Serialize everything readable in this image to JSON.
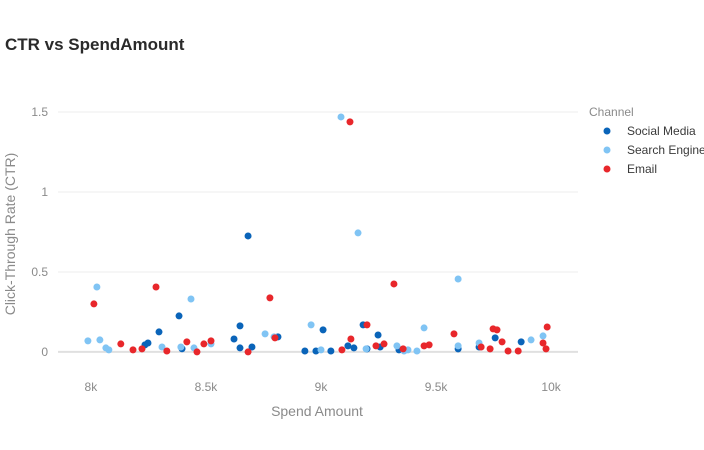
{
  "chart_data": {
    "type": "scatter",
    "title": "CTR vs SpendAmount",
    "xlabel": "Spend Amount",
    "ylabel": "Click-Through Rate (CTR)",
    "xlim": [
      7857,
      10117
    ],
    "ylim": [
      -0.063,
      1.625
    ],
    "x_ticks": [
      {
        "value": 8000,
        "label": "8k"
      },
      {
        "value": 8500,
        "label": "8.5k"
      },
      {
        "value": 9000,
        "label": "9k"
      },
      {
        "value": 9500,
        "label": "9.5k"
      },
      {
        "value": 10000,
        "label": "10k"
      }
    ],
    "y_ticks": [
      {
        "value": 0,
        "label": "0"
      },
      {
        "value": 0.5,
        "label": "0.5"
      },
      {
        "value": 1,
        "label": "1"
      },
      {
        "value": 1.5,
        "label": "1.5"
      }
    ],
    "grid": "horizontal",
    "legend": {
      "title": "Channel",
      "placement": "right"
    },
    "series": [
      {
        "name": "Social Media",
        "color": "#0a64b9",
        "points": [
          [
            8235,
            0.044
          ],
          [
            8248,
            0.056
          ],
          [
            8296,
            0.125
          ],
          [
            8383,
            0.225
          ],
          [
            8396,
            0.02
          ],
          [
            8622,
            0.081
          ],
          [
            8648,
            0.163
          ],
          [
            8648,
            0.025
          ],
          [
            8683,
            0.725
          ],
          [
            8700,
            0.031
          ],
          [
            8813,
            0.094
          ],
          [
            8930,
            0.006
          ],
          [
            8978,
            0.006
          ],
          [
            9009,
            0.138
          ],
          [
            9043,
            0.006
          ],
          [
            9117,
            0.038
          ],
          [
            9143,
            0.025
          ],
          [
            9183,
            0.169
          ],
          [
            9200,
            0.019
          ],
          [
            9248,
            0.106
          ],
          [
            9257,
            0.031
          ],
          [
            9339,
            0.013
          ],
          [
            9596,
            0.019
          ],
          [
            9687,
            0.031
          ],
          [
            9757,
            0.088
          ],
          [
            9870,
            0.063
          ]
        ]
      },
      {
        "name": "Search Engine",
        "color": "#80c4f4",
        "points": [
          [
            7987,
            0.069
          ],
          [
            8026,
            0.406
          ],
          [
            8039,
            0.075
          ],
          [
            8065,
            0.025
          ],
          [
            8078,
            0.013
          ],
          [
            8309,
            0.031
          ],
          [
            8391,
            0.031
          ],
          [
            8435,
            0.331
          ],
          [
            8448,
            0.025
          ],
          [
            8522,
            0.05
          ],
          [
            8757,
            0.113
          ],
          [
            8796,
            0.094
          ],
          [
            8957,
            0.169
          ],
          [
            9000,
            0.013
          ],
          [
            9087,
            1.469
          ],
          [
            9161,
            0.744
          ],
          [
            9196,
            0.019
          ],
          [
            9330,
            0.038
          ],
          [
            9361,
            0.006
          ],
          [
            9378,
            0.013
          ],
          [
            9417,
            0.006
          ],
          [
            9448,
            0.15
          ],
          [
            9596,
            0.456
          ],
          [
            9596,
            0.038
          ],
          [
            9687,
            0.056
          ],
          [
            9913,
            0.075
          ],
          [
            9965,
            0.1
          ]
        ]
      },
      {
        "name": "Email",
        "color": "#e8272b",
        "points": [
          [
            8013,
            0.3
          ],
          [
            8130,
            0.05
          ],
          [
            8183,
            0.013
          ],
          [
            8222,
            0.019
          ],
          [
            8283,
            0.406
          ],
          [
            8330,
            0.006
          ],
          [
            8417,
            0.063
          ],
          [
            8461,
            0.0
          ],
          [
            8491,
            0.05
          ],
          [
            8522,
            0.069
          ],
          [
            8683,
            0.0
          ],
          [
            8778,
            0.338
          ],
          [
            8800,
            0.088
          ],
          [
            9091,
            0.013
          ],
          [
            9126,
            1.438
          ],
          [
            9130,
            0.081
          ],
          [
            9200,
            0.169
          ],
          [
            9239,
            0.038
          ],
          [
            9274,
            0.05
          ],
          [
            9317,
            0.425
          ],
          [
            9357,
            0.019
          ],
          [
            9448,
            0.038
          ],
          [
            9470,
            0.044
          ],
          [
            9578,
            0.113
          ],
          [
            9696,
            0.031
          ],
          [
            9735,
            0.019
          ],
          [
            9748,
            0.144
          ],
          [
            9765,
            0.138
          ],
          [
            9787,
            0.063
          ],
          [
            9813,
            0.006
          ],
          [
            9857,
            0.006
          ],
          [
            9965,
            0.056
          ],
          [
            9978,
            0.019
          ],
          [
            9983,
            0.156
          ]
        ]
      }
    ]
  }
}
